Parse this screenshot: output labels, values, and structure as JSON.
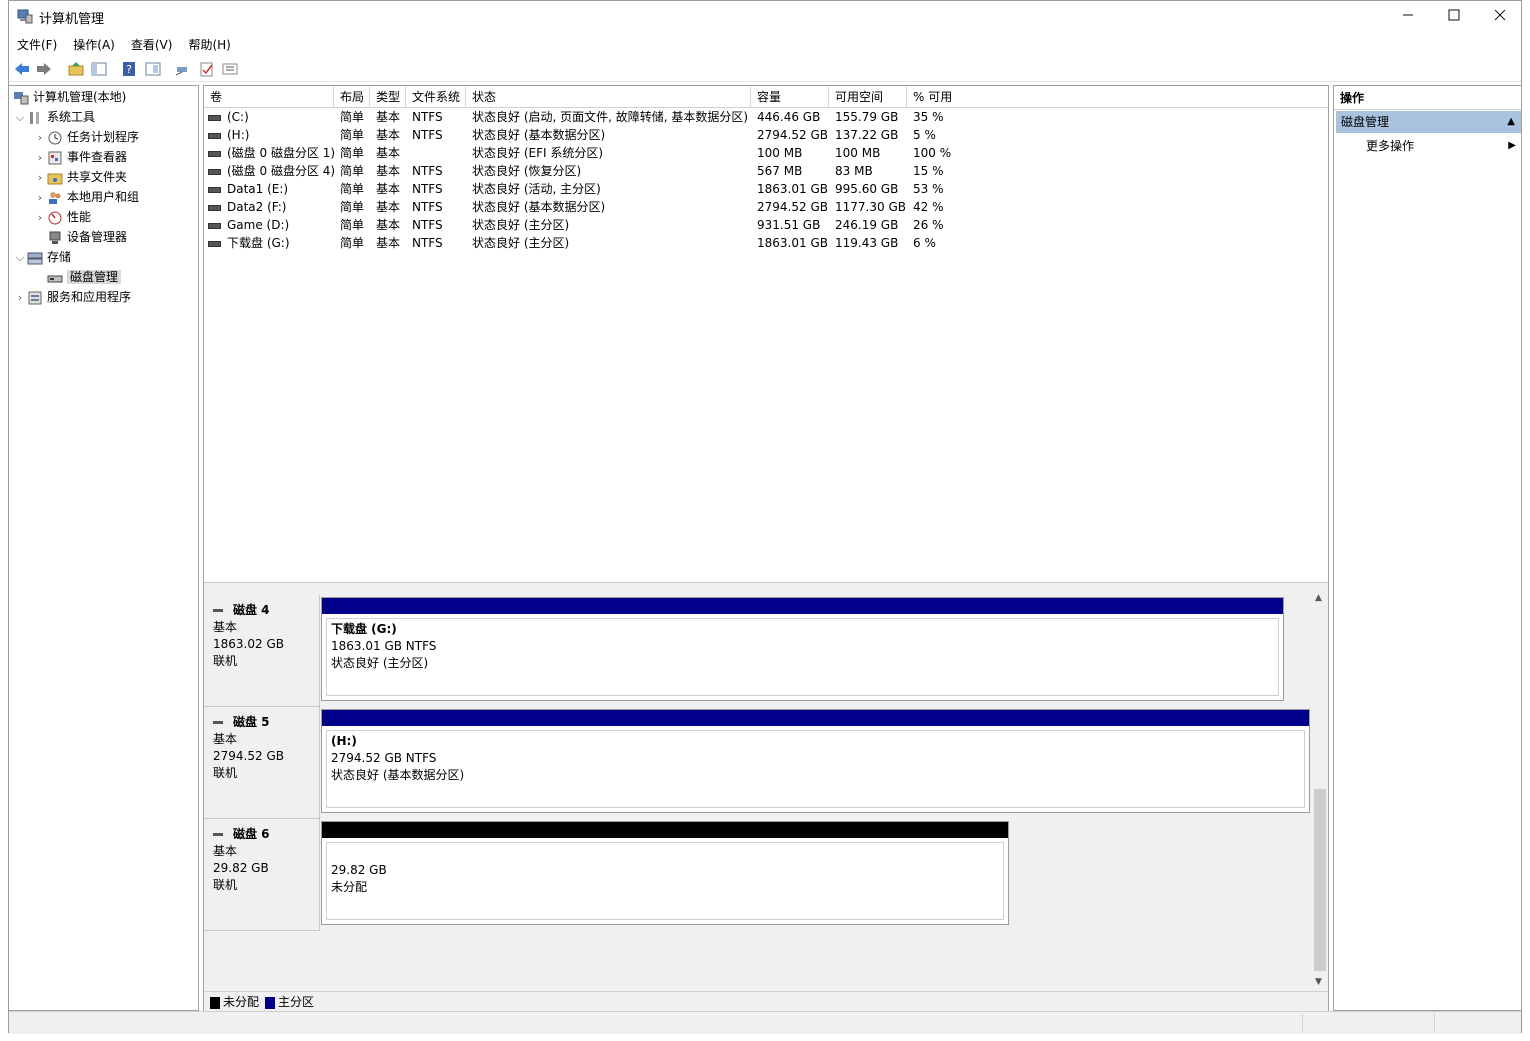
{
  "window": {
    "title": "计算机管理"
  },
  "controls": {
    "minimize": "—",
    "maximize": "☐",
    "close": "✕"
  },
  "menu": [
    "文件(F)",
    "操作(A)",
    "查看(V)",
    "帮助(H)"
  ],
  "tree": {
    "root": "计算机管理(本地)",
    "system_tools": "系统工具",
    "task_scheduler": "任务计划程序",
    "event_viewer": "事件查看器",
    "shared_folders": "共享文件夹",
    "local_users": "本地用户和组",
    "performance": "性能",
    "device_manager": "设备管理器",
    "storage": "存储",
    "disk_management": "磁盘管理",
    "services_apps": "服务和应用程序"
  },
  "columns": [
    "卷",
    "布局",
    "类型",
    "文件系统",
    "状态",
    "容量",
    "可用空间",
    "% 可用"
  ],
  "volumes": [
    {
      "name": "(C:)",
      "layout": "简单",
      "type": "基本",
      "fs": "NTFS",
      "status": "状态良好 (启动, 页面文件, 故障转储, 基本数据分区)",
      "capacity": "446.46 GB",
      "free": "155.79 GB",
      "pct": "35 %"
    },
    {
      "name": "(H:)",
      "layout": "简单",
      "type": "基本",
      "fs": "NTFS",
      "status": "状态良好 (基本数据分区)",
      "capacity": "2794.52 GB",
      "free": "137.22 GB",
      "pct": "5 %"
    },
    {
      "name": "(磁盘 0 磁盘分区 1)",
      "layout": "简单",
      "type": "基本",
      "fs": "",
      "status": "状态良好 (EFI 系统分区)",
      "capacity": "100 MB",
      "free": "100 MB",
      "pct": "100 %"
    },
    {
      "name": "(磁盘 0 磁盘分区 4)",
      "layout": "简单",
      "type": "基本",
      "fs": "NTFS",
      "status": "状态良好 (恢复分区)",
      "capacity": "567 MB",
      "free": "83 MB",
      "pct": "15 %"
    },
    {
      "name": "Data1 (E:)",
      "layout": "简单",
      "type": "基本",
      "fs": "NTFS",
      "status": "状态良好 (活动, 主分区)",
      "capacity": "1863.01 GB",
      "free": "995.60 GB",
      "pct": "53 %"
    },
    {
      "name": "Data2 (F:)",
      "layout": "简单",
      "type": "基本",
      "fs": "NTFS",
      "status": "状态良好 (基本数据分区)",
      "capacity": "2794.52 GB",
      "free": "1177.30 GB",
      "pct": "42 %"
    },
    {
      "name": "Game (D:)",
      "layout": "简单",
      "type": "基本",
      "fs": "NTFS",
      "status": "状态良好 (主分区)",
      "capacity": "931.51 GB",
      "free": "246.19 GB",
      "pct": "26 %"
    },
    {
      "name": "下载盘 (G:)",
      "layout": "简单",
      "type": "基本",
      "fs": "NTFS",
      "status": "状态良好 (主分区)",
      "capacity": "1863.01 GB",
      "free": "119.43 GB",
      "pct": "6 %"
    }
  ],
  "disks": [
    {
      "name": "磁盘 4",
      "kind": "基本",
      "size": "1863.02 GB",
      "state": "联机",
      "part_title": "下载盘  (G:)",
      "part_size": "1863.01 GB NTFS",
      "part_status": "状态良好 (主分区)",
      "bar_color": "#00008b"
    },
    {
      "name": "磁盘 5",
      "kind": "基本",
      "size": "2794.52 GB",
      "state": "联机",
      "part_title": "(H:)",
      "part_size": "2794.52 GB NTFS",
      "part_status": "状态良好 (基本数据分区)",
      "bar_color": "#00008b"
    },
    {
      "name": "磁盘 6",
      "kind": "基本",
      "size": "29.82 GB",
      "state": "联机",
      "part_title": "",
      "part_size": "29.82 GB",
      "part_status": "未分配",
      "bar_color": "#000000"
    }
  ],
  "legend": {
    "unallocated": "未分配",
    "primary": "主分区",
    "unallocated_color": "#000000",
    "primary_color": "#00008b"
  },
  "actions": {
    "header": "操作",
    "section": "磁盘管理",
    "more": "更多操作"
  }
}
